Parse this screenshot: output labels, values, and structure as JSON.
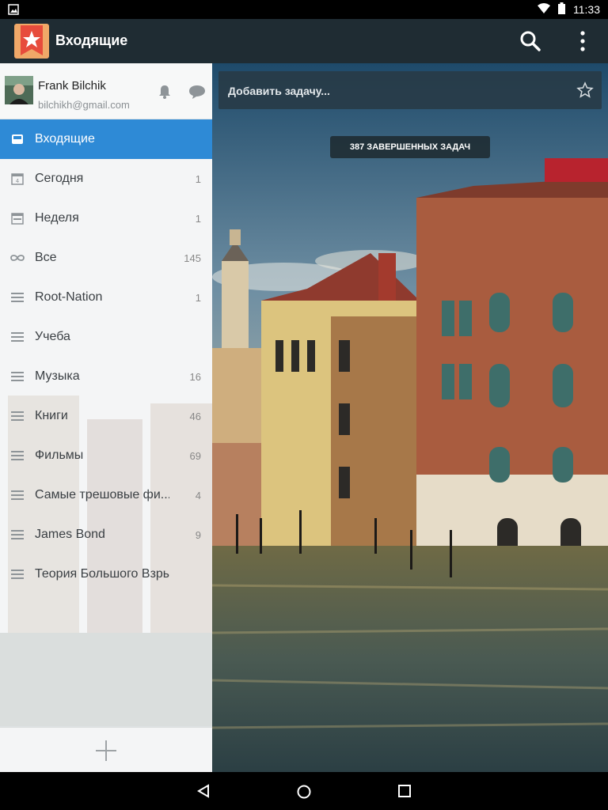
{
  "status": {
    "time": "11:33"
  },
  "app": {
    "title": "Входящие"
  },
  "profile": {
    "name": "Frank Bilchik",
    "email": "bilchikh@gmail.com"
  },
  "task_input": {
    "placeholder": "Добавить задачу..."
  },
  "completed": {
    "label": "387 ЗАВЕРШЕННЫХ ЗАДАЧ"
  },
  "lists": [
    {
      "label": "Входящие",
      "count": "",
      "icon": "inbox-icon",
      "active": true
    },
    {
      "label": "Сегодня",
      "count": "1",
      "icon": "calendar-day-icon"
    },
    {
      "label": "Неделя",
      "count": "1",
      "icon": "calendar-week-icon"
    },
    {
      "label": "Все",
      "count": "145",
      "icon": "infinity-icon"
    },
    {
      "label": "Root-Nation",
      "count": "1",
      "icon": "list-icon"
    },
    {
      "label": "Учеба",
      "count": "",
      "icon": "list-icon"
    },
    {
      "label": "Музыка",
      "count": "16",
      "icon": "list-icon"
    },
    {
      "label": "Книги",
      "count": "46",
      "icon": "list-icon"
    },
    {
      "label": "Фильмы",
      "count": "69",
      "icon": "list-icon"
    },
    {
      "label": "Самые трешовые фи...",
      "count": "4",
      "icon": "list-icon"
    },
    {
      "label": "James Bond",
      "count": "9",
      "icon": "list-icon"
    },
    {
      "label": "Теория Большого Взрыва",
      "count": "",
      "icon": "list-icon"
    }
  ],
  "colors": {
    "accent": "#2e8ad6",
    "appbar": "#1f2c33",
    "logo": "#e74c3c"
  }
}
